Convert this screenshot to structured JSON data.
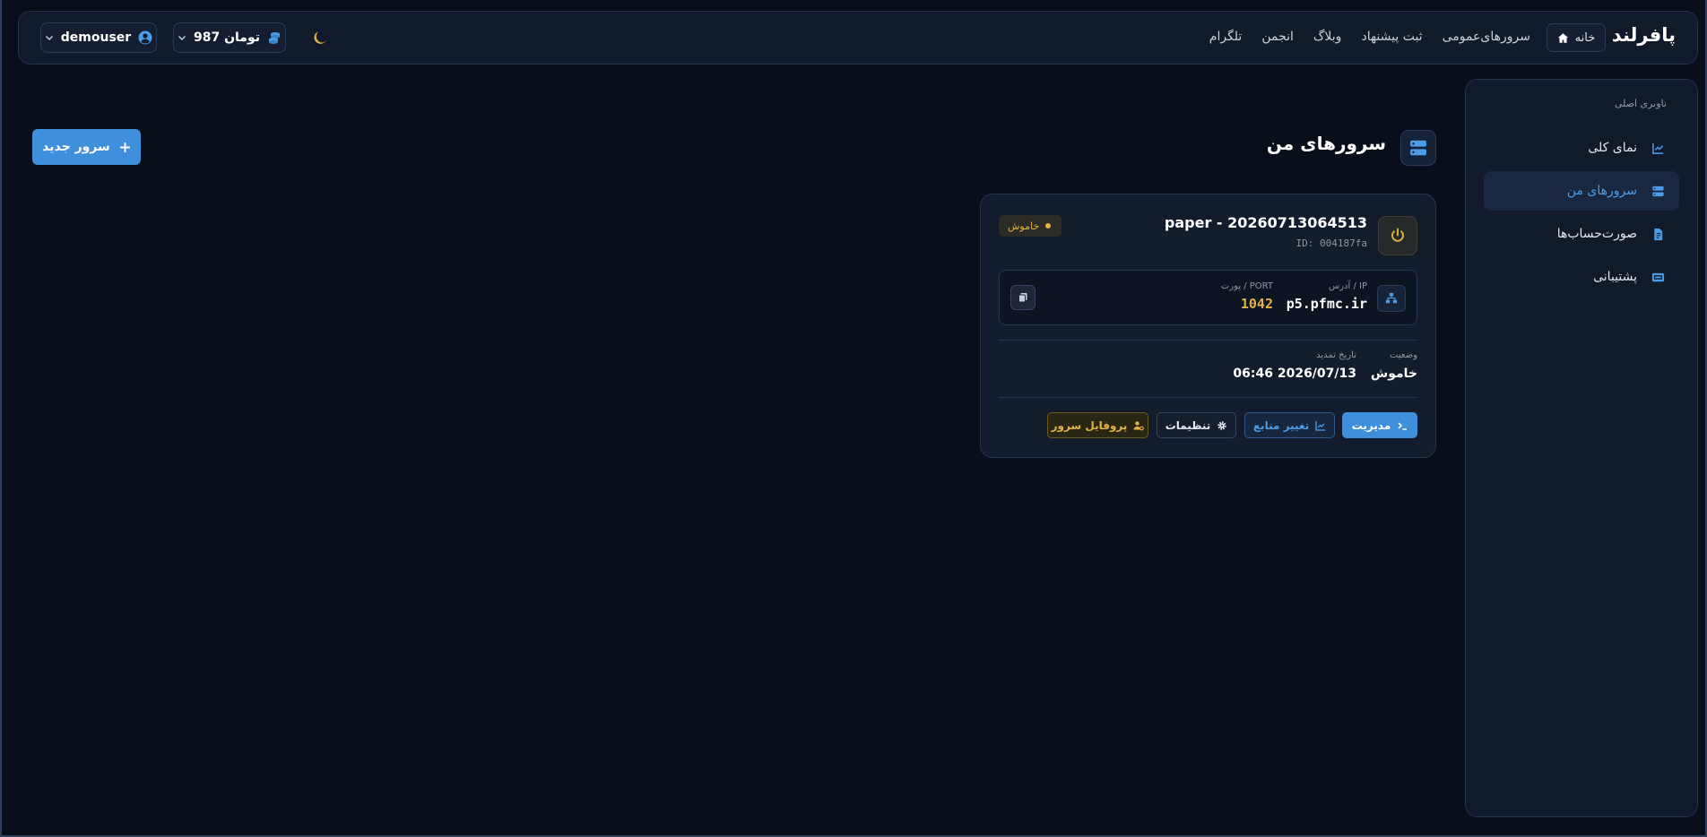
{
  "header": {
    "brand": "پافرلند",
    "home_label": "خانه",
    "nav": [
      "سرورهای‌عمومی",
      "ثبت پیشنهاد",
      "وبلاگ",
      "انجمن",
      "تلگرام"
    ],
    "balance": "987 تومان",
    "username": "demouser"
  },
  "sidebar": {
    "title": "ناوبری اصلی",
    "items": [
      {
        "label": "نمای کلی",
        "icon": "chart-icon"
      },
      {
        "label": "سرورهای من",
        "icon": "server-icon"
      },
      {
        "label": "صورت‌حساب‌ها",
        "icon": "invoice-icon"
      },
      {
        "label": "پشتیبانی",
        "icon": "support-icon"
      }
    ]
  },
  "main": {
    "title": "سرورهای من",
    "new_server": "سرور جدید"
  },
  "server": {
    "name": "paper - 20260713064513",
    "id": "ID: 004187fa",
    "status_badge": "خاموش",
    "ip_label": "آدرس / IP",
    "ip": "p5.pfmc.ir",
    "port_label": "پورت / PORT",
    "port": "1042",
    "status_label": "وضعیت",
    "status_value": "خاموش",
    "renew_label": "تاریخ تمدید",
    "renew_value": "06:46 2026/07/13",
    "buttons": {
      "manage": "مدیریت",
      "resources": "تغییر منابع",
      "settings": "تنظیمات",
      "profile": "پروفایل سرور"
    }
  },
  "colors": {
    "accent": "#3f8fdc",
    "warning": "#e3b341",
    "background": "#090e1b",
    "panel": "#111a2b"
  }
}
